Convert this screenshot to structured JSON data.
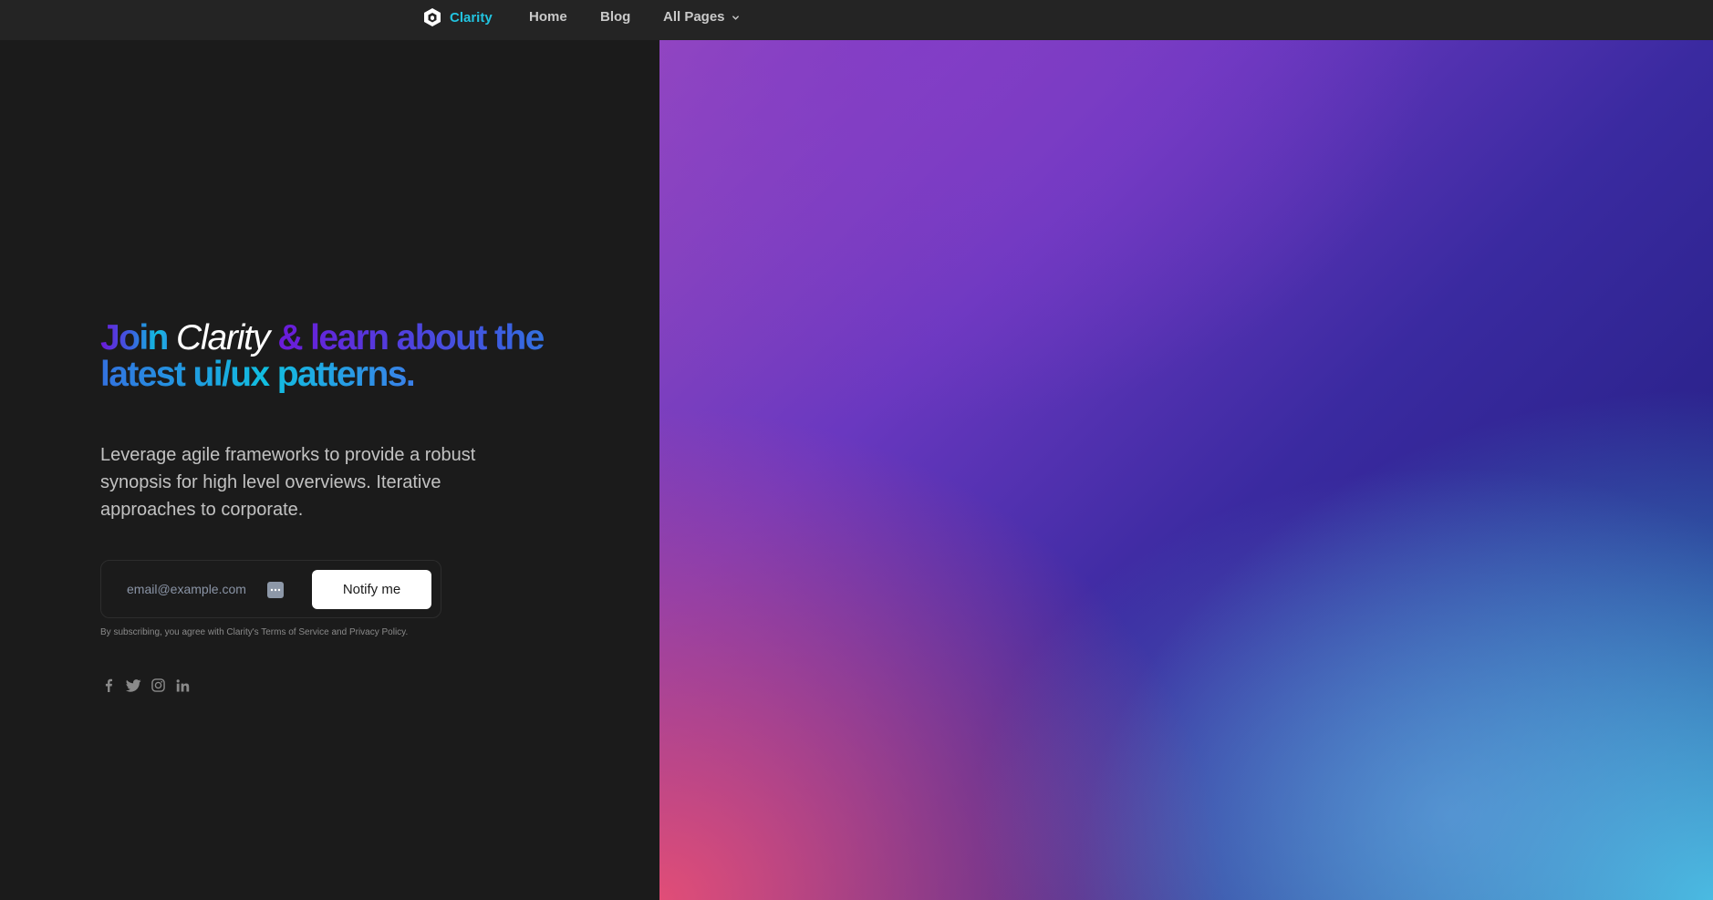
{
  "nav": {
    "brand": "Clarity",
    "links": [
      {
        "label": "Home"
      },
      {
        "label": "Blog"
      },
      {
        "label": "All Pages"
      }
    ]
  },
  "hero": {
    "headline_part1": "Join ",
    "headline_brand": "Clarity",
    "headline_part2": " & learn about the latest ui/ux patterns.",
    "lead": "Leverage agile frameworks to provide a robust synopsis for high level overviews. Iterative approaches to corporate.",
    "form": {
      "email_placeholder": "email@example.com",
      "button_label": "Notify me"
    },
    "terms": "By subscribing, you agree with Clarity's Terms of Service and Privacy Policy.",
    "socials": [
      "facebook-icon",
      "twitter-icon",
      "instagram-icon",
      "linkedin-icon"
    ]
  },
  "colors": {
    "accent": "#22c3df",
    "background": "#1b1b1b",
    "navbar": "#242424"
  }
}
